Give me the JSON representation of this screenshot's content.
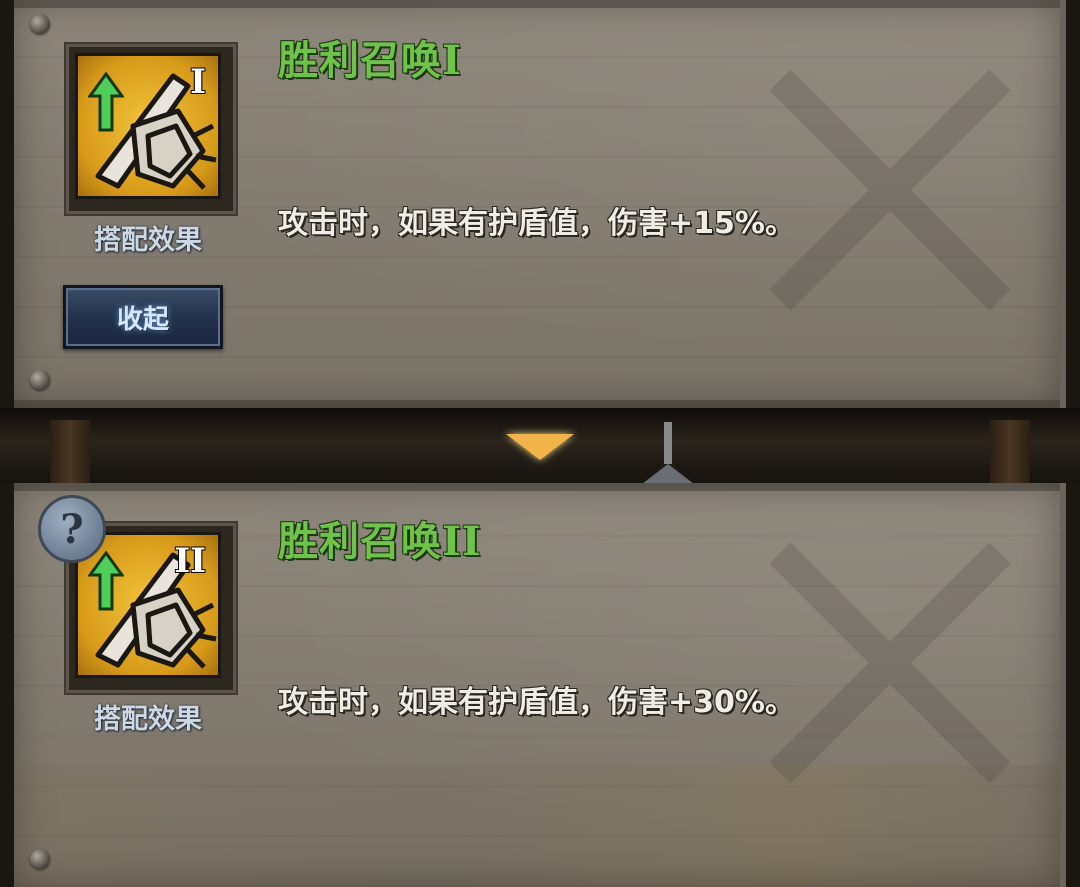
{
  "skills": [
    {
      "title": "胜利召唤",
      "tier": "I",
      "caption": "搭配效果",
      "description": "攻击时，如果有护盾值，伤害+15%。",
      "expanded": true
    },
    {
      "title": "胜利召唤",
      "tier": "II",
      "caption": "搭配效果",
      "description": "攻击时，如果有护盾值，伤害+30%。",
      "expanded": false
    }
  ],
  "collapse_button": {
    "label": "收起"
  },
  "help": {
    "label": "?"
  },
  "colors": {
    "title_green": "#6fc24a",
    "icon_gold": "#f2c43a",
    "parchment": "#8e877c",
    "button_blue": "#22304a",
    "arrow_orange": "#f1b44a"
  },
  "icons": [
    "sword-shield-icon",
    "up-arrow-icon",
    "down-arrow-icon",
    "help-icon"
  ]
}
